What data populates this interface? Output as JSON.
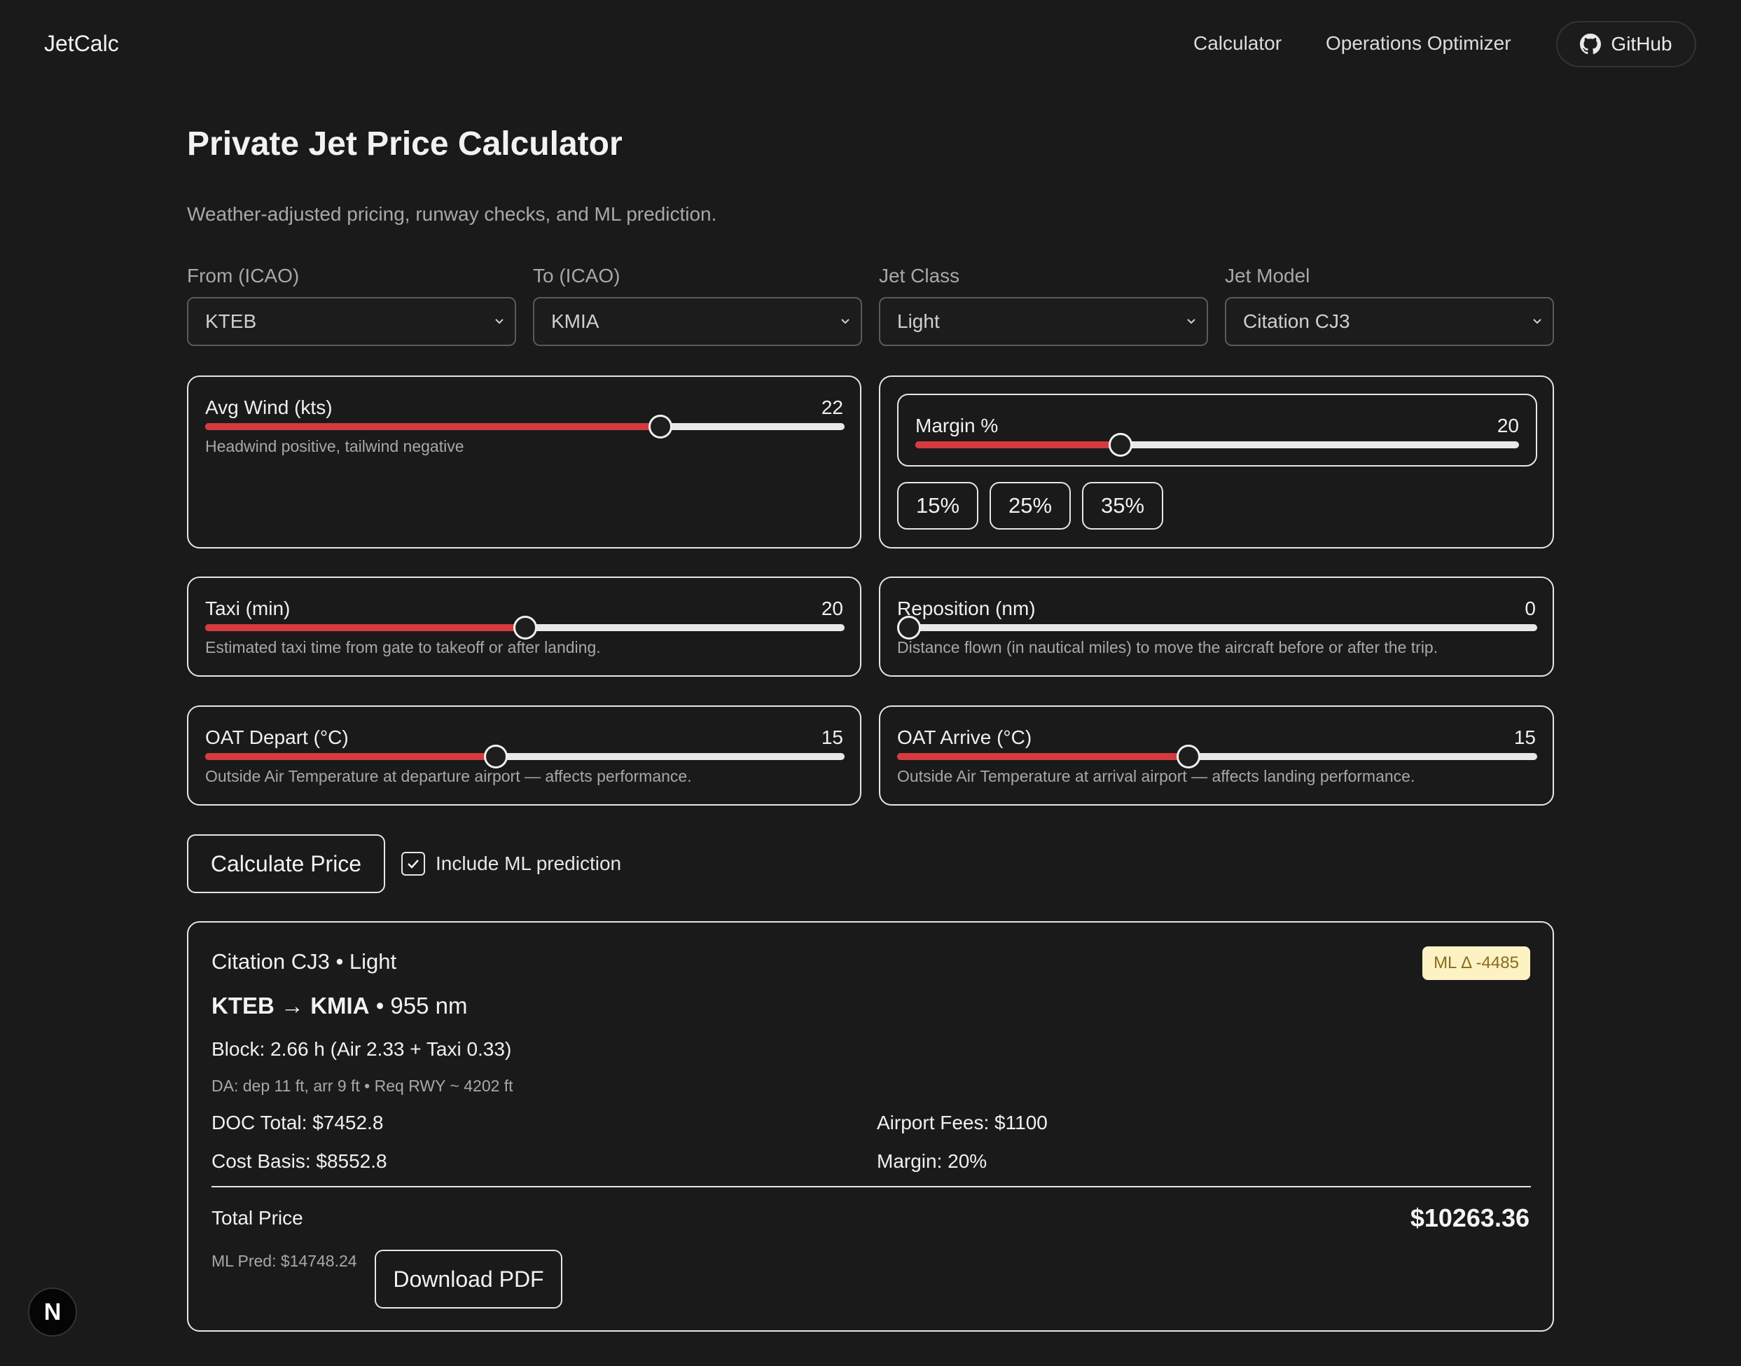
{
  "nav": {
    "brand": "JetCalc",
    "links": [
      "Calculator",
      "Operations Optimizer"
    ],
    "github_label": "GitHub"
  },
  "page": {
    "title": "Private Jet Price Calculator",
    "subtitle": "Weather-adjusted pricing, runway checks, and ML prediction."
  },
  "form": {
    "from": {
      "label": "From (ICAO)",
      "value": "KTEB"
    },
    "to": {
      "label": "To (ICAO)",
      "value": "KMIA"
    },
    "jet_class": {
      "label": "Jet Class",
      "value": "Light"
    },
    "jet_model": {
      "label": "Jet Model",
      "value": "Citation CJ3"
    }
  },
  "sliders": {
    "wind": {
      "label": "Avg Wind (kts)",
      "value": "22",
      "fraction": 0.712,
      "hint": "Headwind positive, tailwind negative"
    },
    "margin": {
      "label": "Margin %",
      "value": "20",
      "fraction": 0.34
    },
    "taxi": {
      "label": "Taxi (min)",
      "value": "20",
      "fraction": 0.5,
      "hint": "Estimated taxi time from gate to takeoff or after landing."
    },
    "reposition": {
      "label": "Reposition (nm)",
      "value": "0",
      "fraction": 0.0,
      "hint": "Distance flown (in nautical miles) to move the aircraft before or after the trip."
    },
    "oat_depart": {
      "label": "OAT Depart (°C)",
      "value": "15",
      "fraction": 0.455,
      "hint": "Outside Air Temperature at departure airport — affects performance."
    },
    "oat_arrive": {
      "label": "OAT Arrive (°C)",
      "value": "15",
      "fraction": 0.455,
      "hint": "Outside Air Temperature at arrival airport — affects landing performance."
    }
  },
  "margin_presets": [
    "15%",
    "25%",
    "35%"
  ],
  "actions": {
    "calculate_label": "Calculate Price",
    "include_ml_label": "Include ML prediction",
    "include_ml_checked": true
  },
  "result": {
    "aircraft": "Citation CJ3 • Light",
    "route_from": "KTEB",
    "route_arrow": "→",
    "route_to": "KMIA",
    "distance": "• 955 nm",
    "block": "Block: 2.66 h (Air 2.33 + Taxi 0.33)",
    "da": "DA: dep 11 ft, arr 9 ft • Req RWY ~ 4202 ft",
    "doc_total": "DOC Total: $7452.8",
    "airport_fees": "Airport Fees: $1100",
    "cost_basis": "Cost Basis: $8552.8",
    "margin": "Margin: 20%",
    "total_label": "Total Price",
    "total_value": "$10263.36",
    "ml_pred": "ML Pred: $14748.24",
    "ml_badge": "ML Δ -4485",
    "download_label": "Download PDF"
  },
  "colors": {
    "background": "#1a1a1a",
    "slider_fill": "#d53a3e",
    "badge_bg": "#fcf2c4",
    "badge_text": "#8a6b18"
  },
  "dev_badge": "N"
}
